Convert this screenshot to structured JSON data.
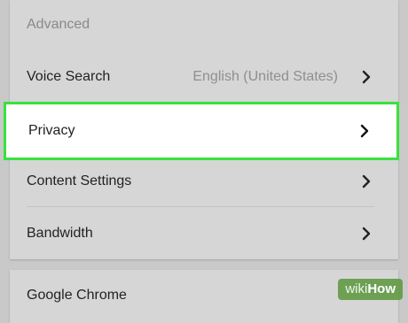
{
  "settings": {
    "section_header": "Advanced",
    "items": [
      {
        "label": "Voice Search",
        "value": "English (United States)"
      },
      {
        "label": "Privacy",
        "value": ""
      },
      {
        "label": "Content Settings",
        "value": ""
      },
      {
        "label": "Bandwidth",
        "value": ""
      }
    ],
    "next_card_title": "Google Chrome"
  },
  "highlight": {
    "item_label": "Privacy",
    "color": "#39e23c"
  },
  "watermark": {
    "text_wiki": "wiki",
    "text_how": "How"
  },
  "colors": {
    "background": "#c9c9c9",
    "card": "#d6d6d6",
    "highlight_fill": "#ffffff"
  },
  "icons": {
    "row_chevron": "chevron-right-icon"
  }
}
